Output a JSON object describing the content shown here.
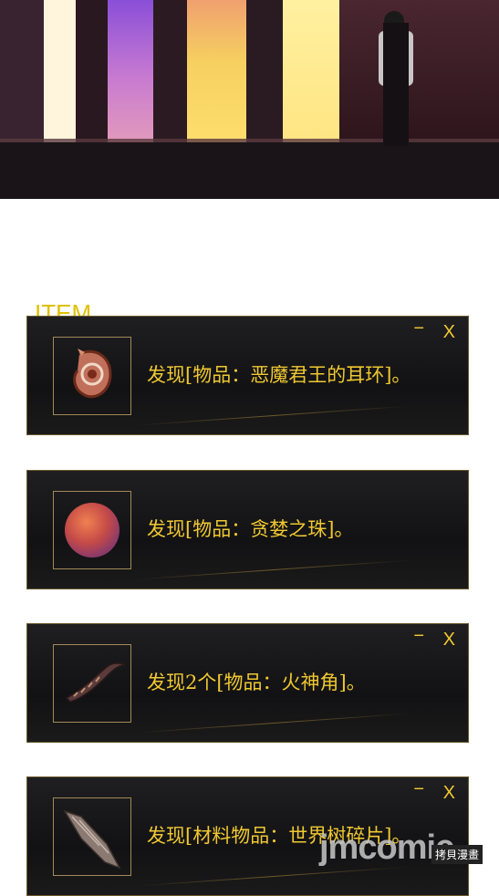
{
  "section_label": "ITEM",
  "cards": [
    {
      "message": "发现[物品：恶魔君王的耳环]。",
      "icon": "demon-king-earring-icon",
      "show_min": "true"
    },
    {
      "message": "发现[物品：贪婪之珠]。",
      "icon": "greed-orb-icon",
      "show_min": "false"
    },
    {
      "message": "发现2个[物品：火神角]。",
      "icon": "fire-god-horn-icon",
      "show_min": "true"
    },
    {
      "message": "发现[材料物品：世界树碎片]。",
      "icon": "world-tree-shard-icon",
      "show_min": "true"
    }
  ],
  "controls": {
    "minimize": "−",
    "close": "X"
  },
  "watermark": {
    "logo": "jmcomic",
    "tag": "拷貝漫畫"
  },
  "colors": {
    "accent": "#f0c830",
    "item_label": "#e0c000",
    "card_bg": "#141416",
    "frame": "#a08a55"
  }
}
